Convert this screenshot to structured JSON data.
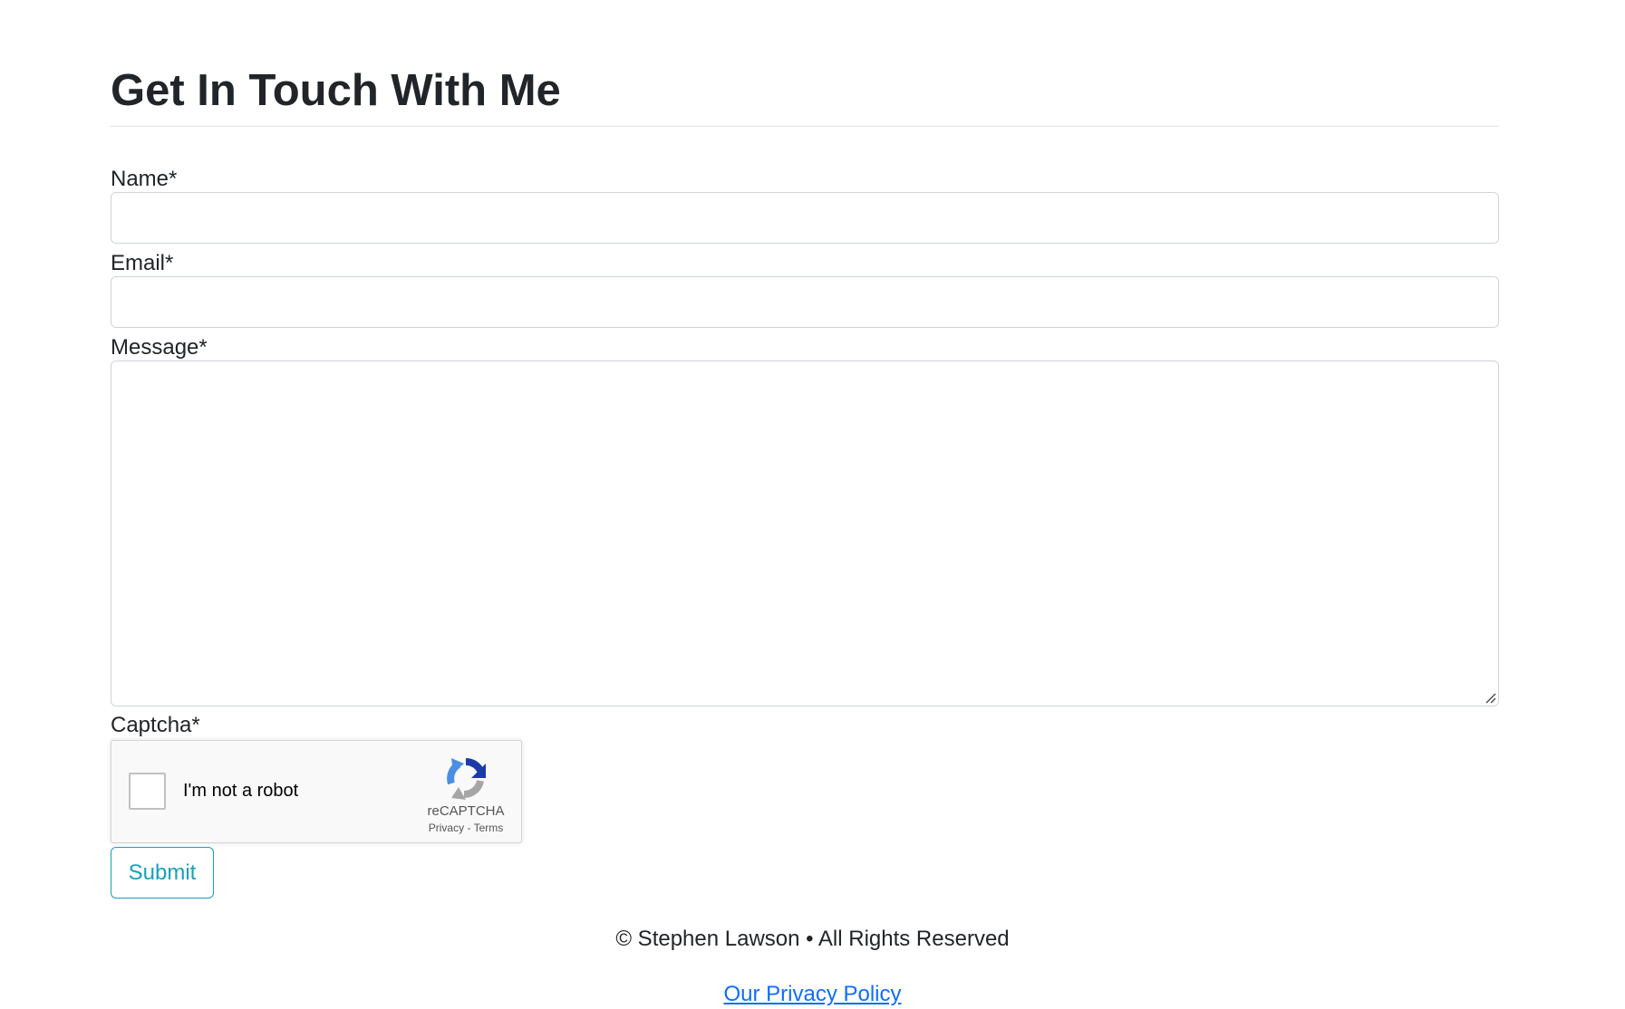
{
  "page": {
    "title": "Get In Touch With Me"
  },
  "form": {
    "name_label": "Name*",
    "name_value": "",
    "email_label": "Email*",
    "email_value": "",
    "message_label": "Message*",
    "message_value": "",
    "captcha_label": "Captcha*",
    "submit_label": "Submit"
  },
  "captcha": {
    "checkbox_text": "I'm not a robot",
    "brand": "reCAPTCHA",
    "privacy_link": "Privacy",
    "separator": " - ",
    "terms_link": "Terms",
    "checked": false
  },
  "footer": {
    "copyright": "© Stephen Lawson • All Rights Reserved",
    "privacy_link": "Our Privacy Policy"
  },
  "colors": {
    "submit_accent": "#17a2b8",
    "link": "#0d6efd",
    "input_border": "#ced4da",
    "text": "#212529"
  }
}
